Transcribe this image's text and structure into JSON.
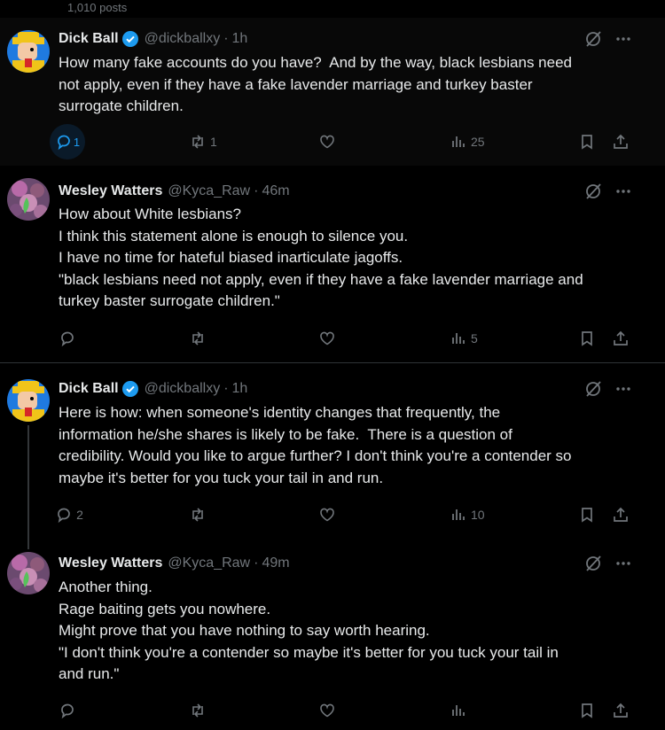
{
  "profile": {
    "post_count": "1,010 posts"
  },
  "colors": {
    "accent": "#1d9bf0",
    "muted": "#71767b",
    "text": "#e7e9ea",
    "border": "#2f3336"
  },
  "icons": [
    "verified-badge-icon",
    "grok-icon",
    "more-icon",
    "reply-icon",
    "retweet-icon",
    "like-icon",
    "views-icon",
    "bookmark-icon",
    "share-icon"
  ],
  "posts": [
    {
      "name": "Dick Ball",
      "handle": "@dickballxy",
      "separator": "·",
      "time": "1h",
      "lines": [
        "How many fake accounts do you have?  And by the way, black lesbians need",
        "not apply, even if they have a fake lavender marriage and turkey baster",
        "surrogate children."
      ],
      "replies": "1",
      "reposts": "1",
      "likes": "",
      "views": "25"
    },
    {
      "name": "Wesley Watters",
      "handle": "@Kyca_Raw",
      "separator": "·",
      "time": "46m",
      "lines": [
        "How about White lesbians?",
        "I think this statement alone is enough to silence you.",
        "I have no time for hateful biased inarticulate jagoffs.",
        "\"black lesbians need not apply, even if they have a fake lavender marriage and",
        "turkey baster surrogate children.\""
      ],
      "replies": "",
      "reposts": "",
      "likes": "",
      "views": "5"
    },
    {
      "name": "Dick Ball",
      "handle": "@dickballxy",
      "separator": "·",
      "time": "1h",
      "lines": [
        "Here is how: when someone's identity changes that frequently, the",
        "information he/she shares is likely to be fake.  There is a question of",
        "credibility. Would you like to argue further? I don't think you're a contender so",
        "maybe it's better for you tuck your tail in and run."
      ],
      "replies": "2",
      "reposts": "",
      "likes": "",
      "views": "10"
    },
    {
      "name": "Wesley Watters",
      "handle": "@Kyca_Raw",
      "separator": "·",
      "time": "49m",
      "lines": [
        "Another thing.",
        "Rage baiting gets you nowhere.",
        "Might prove that you have nothing to say worth hearing.",
        "\"I don't think you're a contender so maybe it's better for you tuck your tail in",
        "and run.\""
      ],
      "replies": "",
      "reposts": "",
      "likes": "",
      "views": ""
    }
  ]
}
